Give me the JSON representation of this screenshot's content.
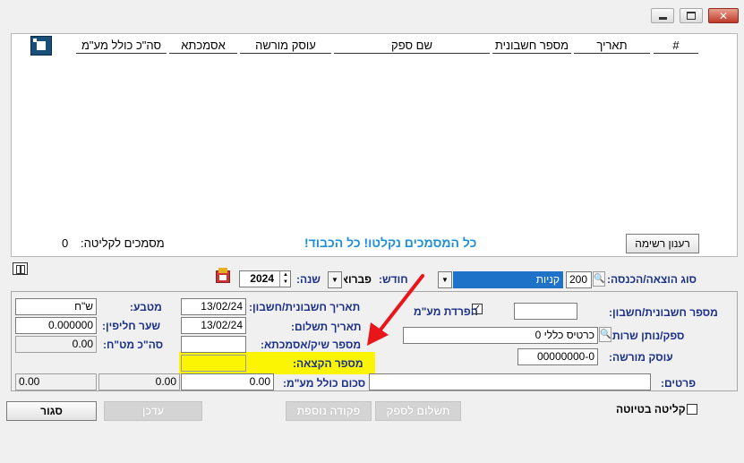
{
  "window": {
    "minimize_icon": "minimize-icon",
    "maximize_icon": "maximize-icon",
    "close_icon": "close-icon"
  },
  "list": {
    "columns": [
      "#",
      "תאריך",
      "מספר חשבונית",
      "שם ספק",
      "עוסק מורשה",
      "אסמכתא",
      "סה\"כ כולל מע\"מ"
    ],
    "refresh_button": "רענון רשימה",
    "status_message": "כל המסמכים נקלטו! כל הכבוד!",
    "docs_to_import_label": "מסמכים לקליטה:",
    "docs_to_import_count": "0"
  },
  "filters": {
    "type_label": "סוג הוצאה/הכנסה:",
    "type_code": "200",
    "type_value": "קניות",
    "month_label": "חודש:",
    "month_value": "פברואר",
    "year_label": "שנה:",
    "year_value": "2024"
  },
  "form": {
    "invoice_no_label": "מספר חשבונית/חשבון:",
    "invoice_no_value": "",
    "vat_separation_label": "הפרדת מע\"מ",
    "vat_separation_checked": true,
    "invoice_date_label": "תאריך חשבונית/חשבון:",
    "invoice_date_value": "13/02/24",
    "payment_date_label": "תאריך תשלום:",
    "payment_date_value": "13/02/24",
    "check_no_label": "מספר שיק/אסמכתא:",
    "check_no_value": "",
    "allocation_no_label": "מספר הקצאה:",
    "allocation_no_value": "",
    "total_label": "סכום כולל מע\"מ:",
    "total_value": "0.00",
    "currency_label": "מטבע:",
    "currency_value": "ש\"ח",
    "exchange_rate_label": "שער חליפין:",
    "exchange_rate_value": "0.000000",
    "total_fx_label": "סה\"כ מט\"ח:",
    "total_fx_value": "0.00",
    "supplier_label": "ספק/נותן שרות:",
    "supplier_value": "כרטיס כללי 0",
    "dealer_label": "עוסק מורשה:",
    "dealer_value": "00000000-0",
    "details_label": "פרטים:",
    "details_value": "",
    "bottom_value_1": "0.00",
    "bottom_value_2": "0.00",
    "bottom_value_3": "0.00"
  },
  "actions": {
    "close": "סגור",
    "update": "עדכן",
    "extra_entry": "פקודה נוספת",
    "pay_supplier": "תשלום לספק",
    "draft_label": "קליטה בטיוטה"
  },
  "colors": {
    "highlight": "#fbf402",
    "arrow": "#e8151b",
    "label_blue": "#1a2f8a",
    "message_blue": "#1e8fd8"
  }
}
